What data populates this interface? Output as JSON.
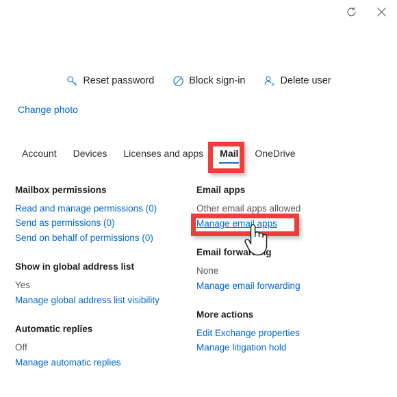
{
  "window": {
    "refresh_icon": "refresh-icon",
    "close_icon": "close-icon"
  },
  "command_bar": {
    "items": [
      {
        "label": "Reset password",
        "icon": "key-icon"
      },
      {
        "label": "Block sign-in",
        "icon": "block-circle-slash-icon"
      },
      {
        "label": "Delete user",
        "icon": "person-delete-icon"
      }
    ]
  },
  "profile": {
    "change_photo_label": "Change photo"
  },
  "tabs": [
    {
      "label": "Account",
      "selected": false
    },
    {
      "label": "Devices",
      "selected": false
    },
    {
      "label": "Licenses and apps",
      "selected": false
    },
    {
      "label": "Mail",
      "selected": true
    },
    {
      "label": "OneDrive",
      "selected": false
    }
  ],
  "left_column": {
    "groups": [
      {
        "title": "Mailbox permissions",
        "links": [
          "Read and manage permissions (0)",
          "Send as permissions (0)",
          "Send on behalf of permissions (0)"
        ]
      },
      {
        "title": "Show in global address list",
        "value": "Yes",
        "links": [
          "Manage global address list visibility"
        ]
      },
      {
        "title": "Automatic replies",
        "value": "Off",
        "links": [
          "Manage automatic replies"
        ]
      }
    ]
  },
  "right_column": {
    "groups": [
      {
        "title": "Email apps",
        "value": "Other email apps allowed",
        "links": [
          "Manage email apps"
        ]
      },
      {
        "title": "Email forwarding",
        "value": "None",
        "links": [
          "Manage email forwarding"
        ]
      },
      {
        "title": "More actions",
        "links": [
          "Edit Exchange properties",
          "Manage litigation hold"
        ]
      }
    ]
  },
  "annotations": {
    "color": "#f23b3b",
    "targets": [
      "Mail",
      "Manage email apps"
    ]
  },
  "colors": {
    "link": "#0066cc",
    "heading": "#201f1e",
    "tab_underline": "#0f6cbd",
    "annotation_red": "#f23b3b",
    "command_icon": "#1a7bc9"
  },
  "cursor": {
    "type": "pointing-hand-cursor"
  }
}
